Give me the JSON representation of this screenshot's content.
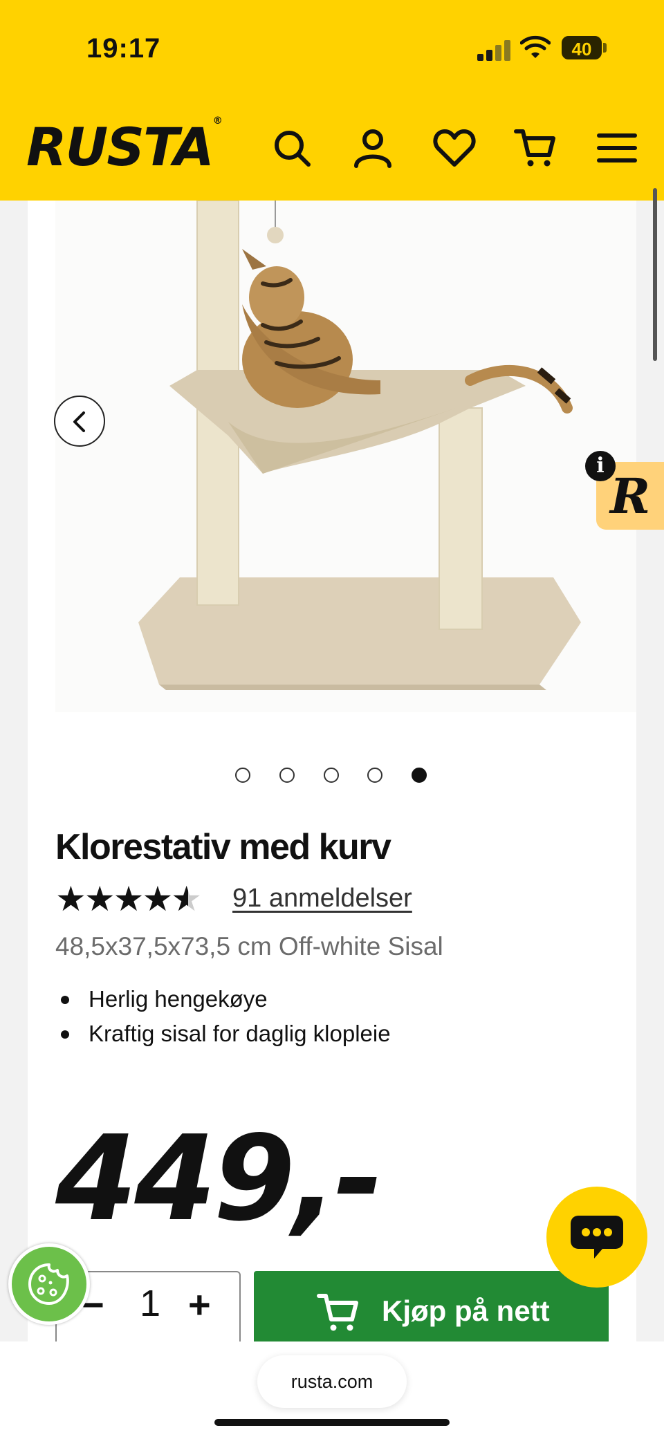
{
  "status_bar": {
    "time": "19:17",
    "battery": "40"
  },
  "header": {
    "logo": "RUSTA",
    "logo_mark": "®"
  },
  "product": {
    "title": "Klorestativ med kurv",
    "rating": 4.5,
    "rating_max": 5,
    "reviews_link": "91 anmeldelser",
    "subtitle": "48,5x37,5x73,5 cm Off-white Sisal",
    "bullets": [
      "Herlig hengekøye",
      "Kraftig sisal for daglig klopleie"
    ],
    "price": "449,-",
    "image_count": 5,
    "active_image": 5
  },
  "purchase": {
    "qty_minus": "−",
    "quantity": "1",
    "qty_plus": "+",
    "buy_label": "Kjøp på nett"
  },
  "widget": {
    "info": "i",
    "letter": "R"
  },
  "browser": {
    "url": "rusta.com"
  },
  "colors": {
    "brand_yellow": "#ffd200",
    "buy_green": "#228a34",
    "cookie_green": "#6cc04a"
  }
}
